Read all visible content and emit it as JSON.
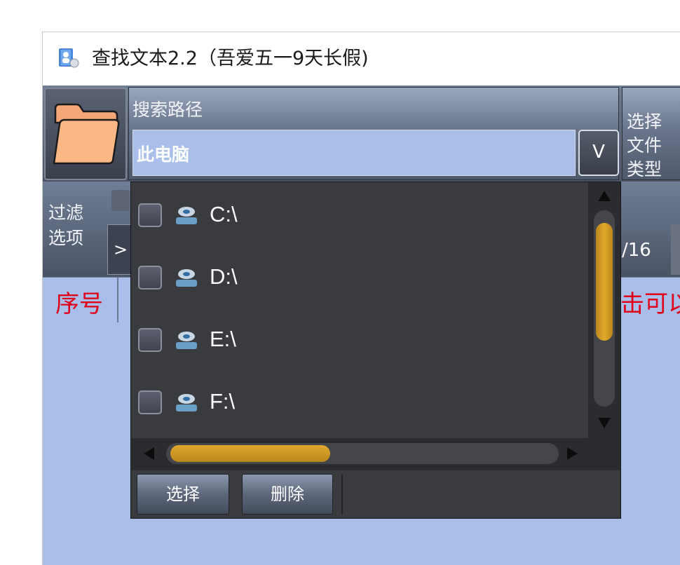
{
  "window": {
    "title": "查找文本2.2（吾爱五一9天长假)"
  },
  "toolbar": {
    "search_path_label": "搜索路径",
    "search_path_value": "此电脑",
    "dropdown_glyph": "V",
    "file_type_label": "选择文件类型",
    "folder_icon": "folder-icon"
  },
  "filter": {
    "label": "过滤选项",
    "expand_glyph": ">",
    "page_count": "/16"
  },
  "table": {
    "columns": [
      "序号",
      "击可以"
    ]
  },
  "drive_popup": {
    "drives": [
      {
        "label": "C:\\",
        "checked": false,
        "icon": "drive-icon"
      },
      {
        "label": "D:\\",
        "checked": false,
        "icon": "drive-icon"
      },
      {
        "label": "E:\\",
        "checked": false,
        "icon": "drive-icon"
      },
      {
        "label": "F:\\",
        "checked": false,
        "icon": "drive-icon"
      }
    ],
    "vertical_scroll": {
      "position": 0.25,
      "visible_fraction": 0.6
    },
    "horizontal_scroll": {
      "position": 0.0,
      "visible_fraction": 0.42
    },
    "select_button": "选择",
    "delete_button": "删除"
  },
  "colors": {
    "accent_scrollbar": "#e1a92b",
    "table_background": "#a9bfe9",
    "header_text": "#e0001a",
    "popup_background": "#3a3b3e"
  }
}
